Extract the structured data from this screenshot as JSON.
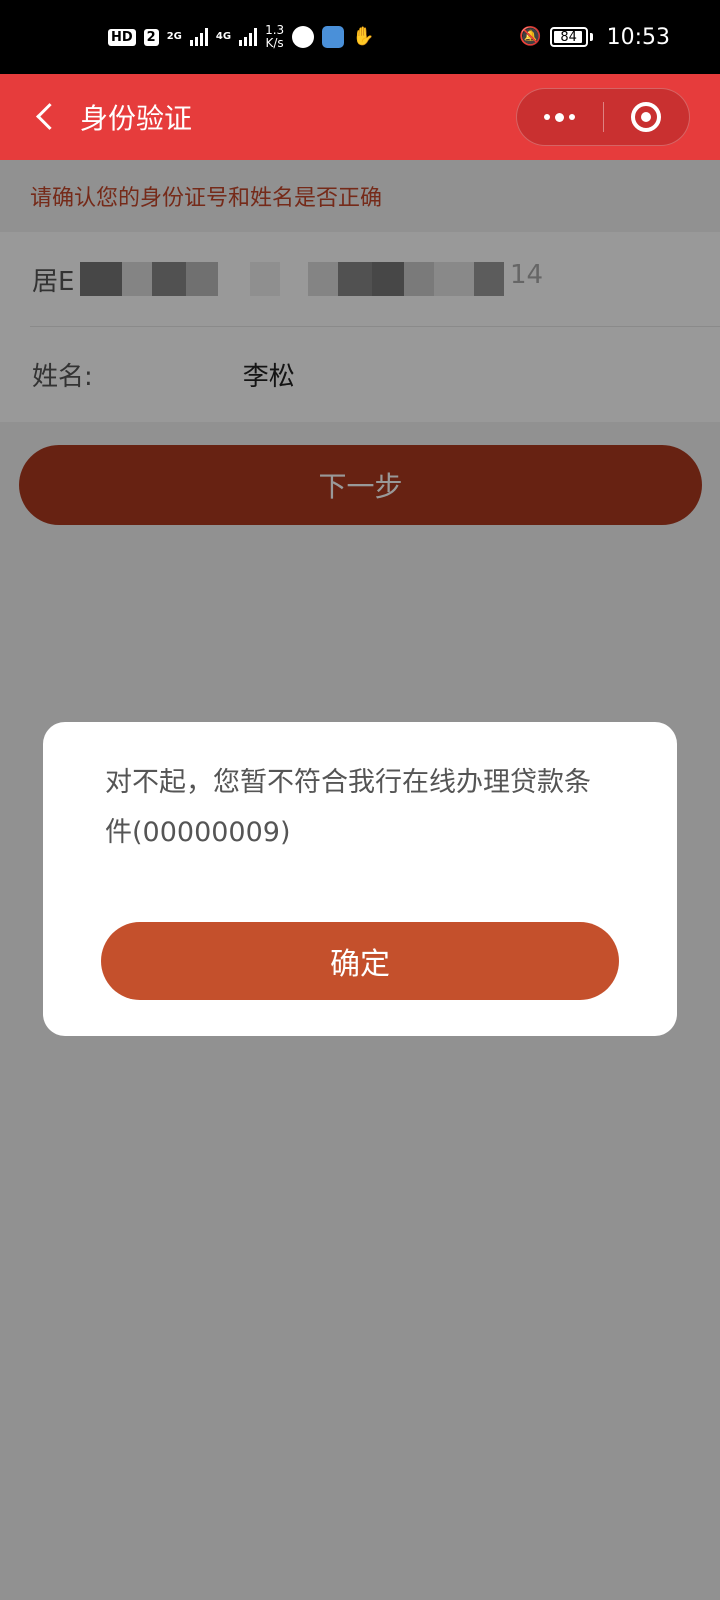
{
  "status_bar": {
    "hd_label": "HD",
    "sim_label": "2",
    "net_1": "2G",
    "net_2": "4G",
    "speed_value": "1.3",
    "speed_unit": "K/s",
    "battery": "84",
    "time": "10:53"
  },
  "header": {
    "title": "身份验证"
  },
  "hint": "请确认您的身份证号和姓名是否正确",
  "form": {
    "id_prefix": "居E",
    "id_suffix": "14",
    "name_label": "姓名:",
    "name_value": "李松"
  },
  "next_button": "下一步",
  "dialog": {
    "message": "对不起，您暂不符合我行在线办理贷款条件(00000009)",
    "confirm_label": "确定"
  },
  "colors": {
    "header_bg": "#e63c3c",
    "hint_text": "#c4472b",
    "next_button_bg": "#ac3a1f",
    "confirm_button_bg": "#c4502c"
  },
  "icons": [
    "back-arrow-icon",
    "more-dots-icon",
    "close-miniprogram-icon",
    "wechat-icon",
    "app-icon",
    "hand-icon",
    "mute-bell-icon",
    "battery-icon",
    "signal-icon"
  ]
}
